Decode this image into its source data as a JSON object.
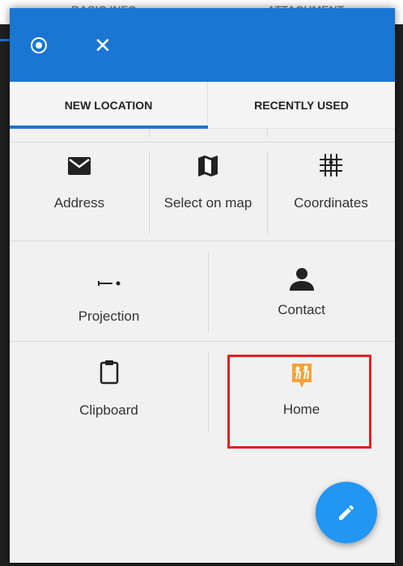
{
  "background": {
    "tabs": [
      "BASIC INFO",
      "ATTACHMENT"
    ]
  },
  "dialog": {
    "appbar": {
      "target_icon": "target-icon",
      "close_icon": "close-icon",
      "close_glyph": "✕"
    },
    "tabs": [
      {
        "label": "NEW LOCATION",
        "selected": true
      },
      {
        "label": "RECENTLY USED",
        "selected": false
      }
    ],
    "options": [
      {
        "label": "Address",
        "icon": "envelope-icon"
      },
      {
        "label": "Select on map",
        "icon": "map-icon"
      },
      {
        "label": "Coordinates",
        "icon": "grid-icon"
      },
      {
        "label": "Projection",
        "icon": "projection-icon"
      },
      {
        "label": "Contact",
        "icon": "person-icon"
      },
      {
        "label": "Clipboard",
        "icon": "clipboard-icon"
      },
      {
        "label": "Home",
        "icon": "home-family-icon"
      }
    ],
    "colors": {
      "accent": "#1976d2",
      "fab": "#2196f3",
      "highlight": "#e02020",
      "home_icon": "#f2a23a"
    },
    "fab_icon": "pencil-icon"
  }
}
